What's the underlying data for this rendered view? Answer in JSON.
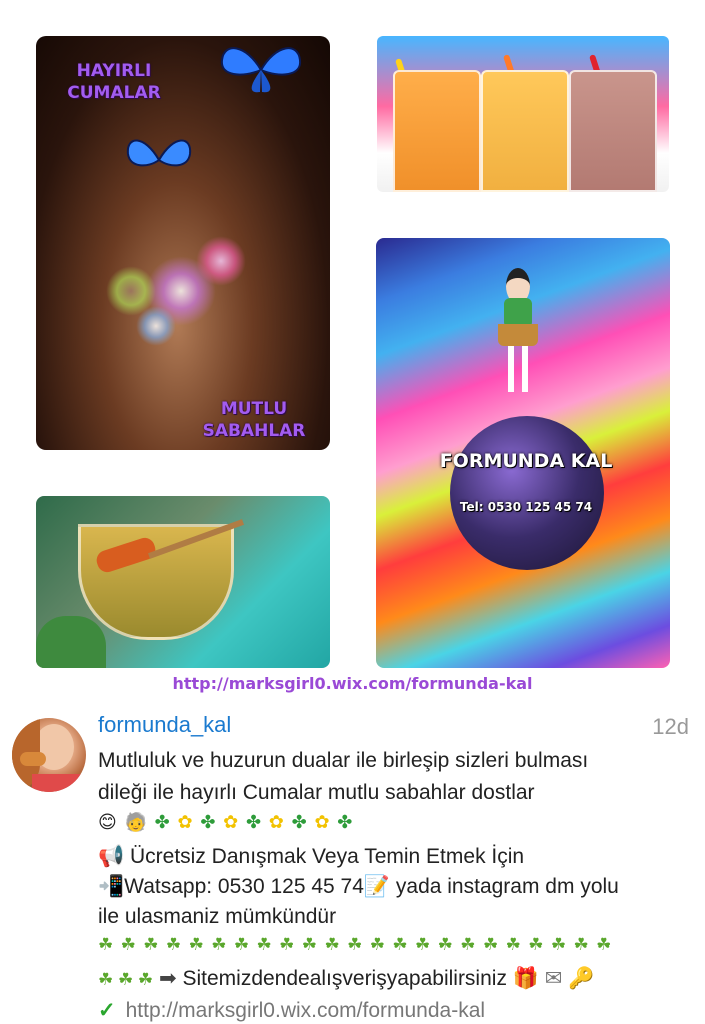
{
  "collage": {
    "hands_text_top": "HAYIRLI CUMALAR",
    "hands_text_bottom": "MUTLU SABAHLAR",
    "brand_name": "FORMUNDA KAL",
    "brand_phone": "Tel: 0530 125 45 74",
    "url_caption": "http://marksgirl0.wix.com/formunda-kal"
  },
  "post": {
    "username": "formunda_kal",
    "timestamp": "12d",
    "line1": "Mutluluk ve huzurun dualar ile birleşip sizleri bulması",
    "line2": "dileği ile hayırlı Cumalar mutlu sabahlar dostlar",
    "line4": "Ücretsiz Danışmak Veya Temin Etmek İçin",
    "line5": "Watsapp: 0530 125 45 74",
    "line5_suffix": " yada instagram dm yolu",
    "line6": "ile ulasmaniz mümkündür",
    "line8_arrow": "➡",
    "line8": "Sitemizdendealışverişyapabilirsiniz",
    "link": "http://marksgirl0.wix.com/formunda-kal"
  },
  "icons": [
    "smile-icon",
    "person-icon",
    "clover-icon",
    "flower-icon",
    "megaphone-icon",
    "phone-icon",
    "memo-icon",
    "leaf-icon",
    "gift-icon",
    "mail-icon",
    "key-icon",
    "check-icon"
  ],
  "colors": {
    "username": "#1a7acf",
    "caption": "#9a4ad6",
    "check": "#2aa62e"
  }
}
